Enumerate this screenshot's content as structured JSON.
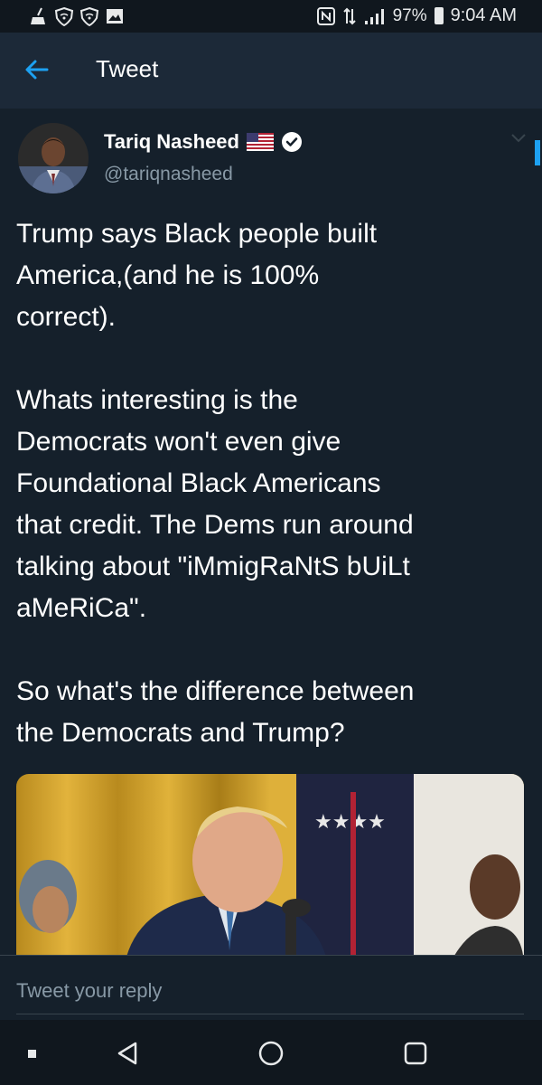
{
  "status_bar": {
    "battery": "97%",
    "time": "9:04 AM",
    "icons": [
      "broom-icon",
      "shield-wifi-icon",
      "shield-wifi-icon",
      "gallery-icon",
      "nfc-icon",
      "data-arrows-icon",
      "signal-icon",
      "battery-icon"
    ]
  },
  "header": {
    "title": "Tweet",
    "back_icon": "arrow-left-icon"
  },
  "tweet": {
    "author_name": "Tariq Nasheed",
    "handle": "@tariqnasheed",
    "badges": [
      "us-flag-icon",
      "verified-badge-icon"
    ],
    "text_lines": [
      [
        "Trump says Black people built",
        "America,(and he is 100%",
        "correct)."
      ],
      [
        "Whats interesting is the",
        "Democrats won't even give",
        "Foundational Black Americans",
        "that credit. The Dems run around",
        "talking about \"iMmigRaNtS bUiLt",
        "aMeRiCa\"."
      ],
      [
        "So what's the difference between",
        "the Democrats and Trump?"
      ]
    ]
  },
  "reply": {
    "placeholder": "Tweet your reply"
  },
  "nav": {
    "icons": [
      "recents-dot-icon",
      "back-triangle-icon",
      "home-circle-icon",
      "overview-square-icon"
    ]
  },
  "colors": {
    "background": "#15202b",
    "header": "#1c2938",
    "accent": "#1da1f2",
    "secondary_text": "#8899a6"
  }
}
